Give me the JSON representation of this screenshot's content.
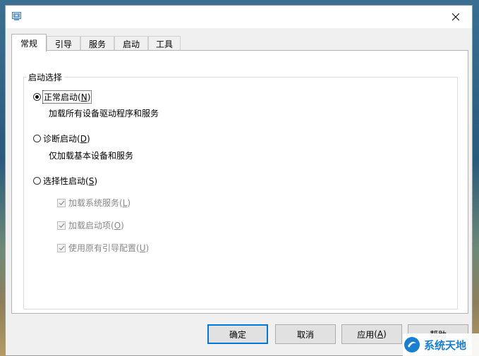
{
  "tabs": [
    "常规",
    "引导",
    "服务",
    "启动",
    "工具"
  ],
  "group_title": "启动选择",
  "options": {
    "normal": {
      "label": "正常启动",
      "mnemonic": "N",
      "description": "加载所有设备驱动程序和服务"
    },
    "diagnostic": {
      "label": "诊断启动",
      "mnemonic": "D",
      "description": "仅加载基本设备和服务"
    },
    "selective": {
      "label": "选择性启动",
      "mnemonic": "S"
    }
  },
  "selective_items": [
    {
      "label": "加载系统服务",
      "mnemonic": "L"
    },
    {
      "label": "加载启动项",
      "mnemonic": "O"
    },
    {
      "label": "使用原有引导配置",
      "mnemonic": "U"
    }
  ],
  "buttons": {
    "ok": "确定",
    "cancel": "取消",
    "apply": "应用",
    "apply_mnemonic": "A",
    "help": "帮助"
  },
  "watermark": "系统天地",
  "colors": {
    "accent": "#0078d7",
    "watermark": "#1b7fd1"
  }
}
